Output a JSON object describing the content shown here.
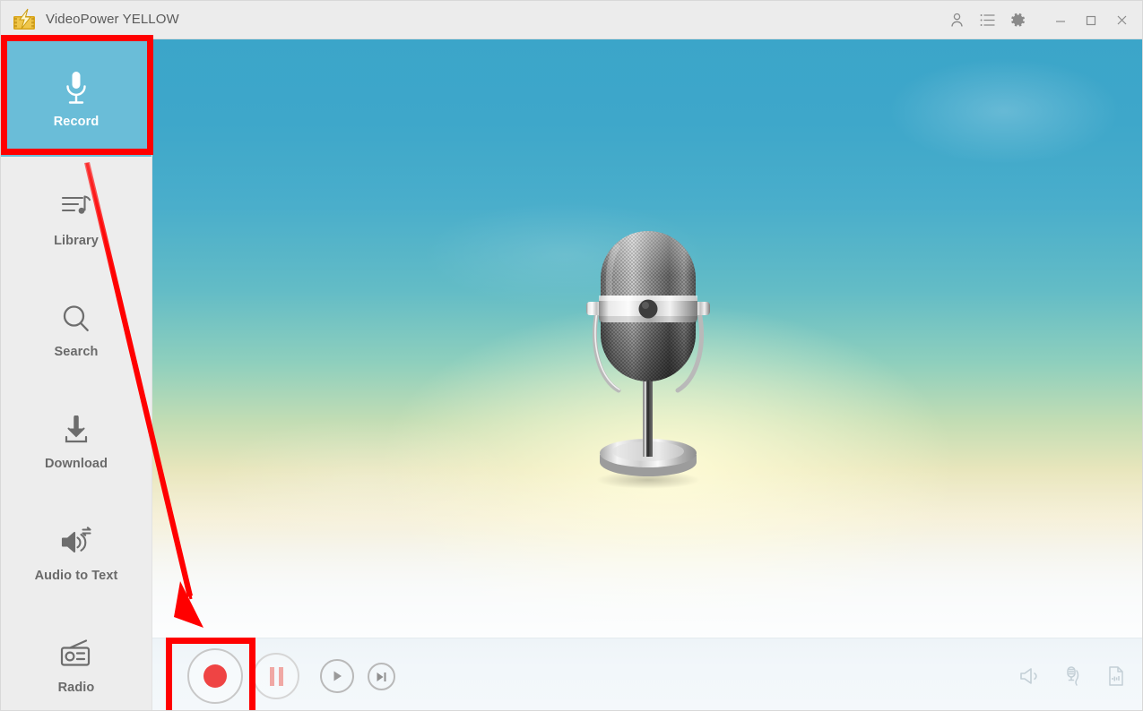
{
  "window": {
    "title": "VideoPower YELLOW",
    "logo_icon": "lightning-film-logo",
    "titlebar_icons": [
      {
        "name": "account-icon",
        "glyph": "person"
      },
      {
        "name": "task-list-icon",
        "glyph": "list"
      },
      {
        "name": "settings-gear-icon",
        "glyph": "gear"
      }
    ],
    "controls": [
      {
        "name": "minimize-button",
        "glyph": "minimize"
      },
      {
        "name": "maximize-button",
        "glyph": "maximize"
      },
      {
        "name": "close-button",
        "glyph": "close"
      }
    ]
  },
  "sidebar": {
    "active": "Record",
    "items": [
      {
        "label": "Record",
        "icon": "microphone-icon",
        "active": true
      },
      {
        "label": "Library",
        "icon": "music-library-icon",
        "active": false
      },
      {
        "label": "Search",
        "icon": "magnifier-icon",
        "active": false
      },
      {
        "label": "Download",
        "icon": "download-arrow-icon",
        "active": false
      },
      {
        "label": "Audio to Text",
        "icon": "speaker-convert-icon",
        "active": false
      },
      {
        "label": "Radio",
        "icon": "radio-icon",
        "active": false
      }
    ]
  },
  "stage": {
    "artwork": "vintage-microphone-illustration",
    "background": "sky-gradient-with-clouds"
  },
  "transport": {
    "buttons": [
      {
        "name": "record-button",
        "icon": "record-dot-icon"
      },
      {
        "name": "pause-button",
        "icon": "pause-bars-icon"
      },
      {
        "name": "play-button",
        "icon": "play-triangle-icon"
      },
      {
        "name": "next-track-button",
        "icon": "skip-next-icon"
      }
    ],
    "right_tools": [
      {
        "name": "volume-icon",
        "icon": "speaker-icon"
      },
      {
        "name": "microphone-source-icon",
        "icon": "mic-plug-icon"
      },
      {
        "name": "output-file-icon",
        "icon": "waveform-file-icon"
      }
    ]
  },
  "annotations": {
    "highlight_color": "#ff0000",
    "boxes": [
      {
        "name": "record-nav-highlight",
        "target": "Record"
      },
      {
        "name": "record-button-highlight",
        "target": "record-button"
      }
    ],
    "arrow": {
      "name": "guide-arrow",
      "from": "Record nav item",
      "to": "record-button"
    }
  },
  "colors": {
    "accent_teal": "#6abdd8",
    "sidebar_bg": "#ededed",
    "titlebar_bg": "#ececec",
    "record_red": "#ef4444",
    "pause_pink": "#f0a8a4",
    "annotation_red": "#ff0000"
  }
}
